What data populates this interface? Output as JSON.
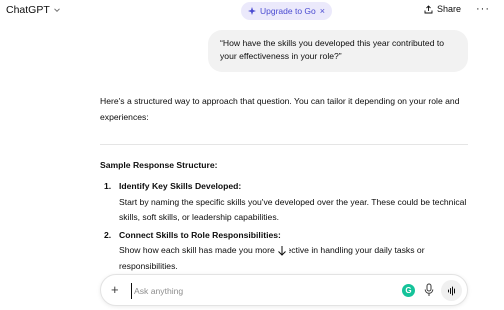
{
  "header": {
    "app_title": "ChatGPT",
    "upgrade_label": "Upgrade to Go",
    "upgrade_close": "×",
    "share_label": "Share",
    "more_label": "···"
  },
  "user_message": "“How have the skills you developed this year contributed to your effectiveness in your role?”",
  "assistant": {
    "intro": "Here's a structured way to approach that question. You can tailor it depending on your role and experiences:",
    "section_title": "Sample Response Structure:",
    "items": [
      {
        "number": "1.",
        "title": "Identify Key Skills Developed:",
        "body": "Start by naming the specific skills you've developed over the year. These could be technical skills, soft skills, or leadership capabilities."
      },
      {
        "number": "2.",
        "title": "Connect Skills to Role Responsibilities:",
        "body": "Show how each skill has made you more effective in handling your daily tasks or responsibilities."
      }
    ]
  },
  "composer": {
    "placeholder": "Ask anything"
  },
  "colors": {
    "upgrade_bg": "#ebe9fb",
    "upgrade_text": "#4a4bd1",
    "bubble_bg": "#f2f2f2",
    "grammarly": "#15c39a"
  },
  "icons": {
    "title_chevron": "chevron-down-icon",
    "upgrade": "sparkle-icon",
    "share": "share-icon",
    "composer_add": "plus-icon",
    "scroll": "arrow-down-icon",
    "grammarly": "grammarly-icon",
    "mic": "microphone-icon",
    "voice": "voice-mode-icon"
  }
}
